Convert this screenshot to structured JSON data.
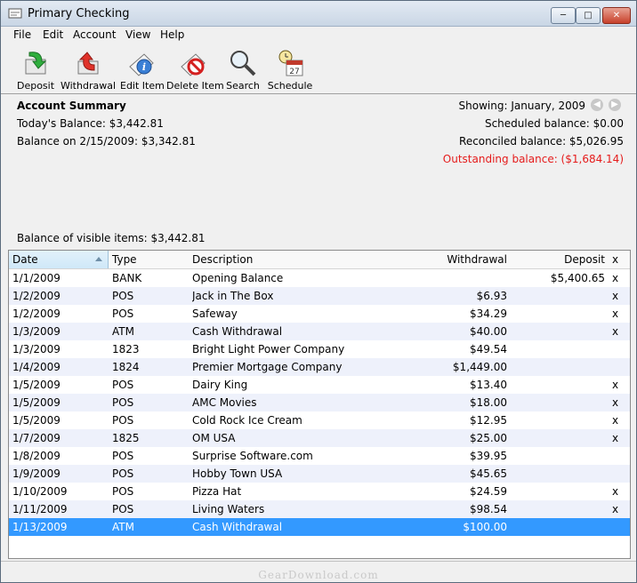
{
  "window": {
    "title": "Primary Checking"
  },
  "menu": [
    "File",
    "Edit",
    "Account",
    "View",
    "Help"
  ],
  "toolbar": {
    "deposit": "Deposit",
    "withdrawal": "Withdrawal",
    "edit_item": "Edit Item",
    "delete_item": "Delete Item",
    "search": "Search",
    "schedule": "Schedule",
    "schedule_day": "27"
  },
  "summary": {
    "heading": "Account Summary",
    "todays_balance": "Today's Balance: $3,442.81",
    "balance_on": "Balance on 2/15/2009: $3,342.81",
    "showing": "Showing: January, 2009",
    "scheduled": "Scheduled balance: $0.00",
    "reconciled": "Reconciled balance: $5,026.95",
    "outstanding": "Outstanding balance: ($1,684.14)",
    "visible": "Balance of visible items: $3,442.81"
  },
  "table": {
    "columns": {
      "date": "Date",
      "type": "Type",
      "description": "Description",
      "withdrawal": "Withdrawal",
      "deposit": "Deposit",
      "x": "x"
    },
    "rows": [
      {
        "date": "1/1/2009",
        "type": "BANK",
        "description": "Opening Balance",
        "withdrawal": "",
        "deposit": "$5,400.65",
        "x": "x"
      },
      {
        "date": "1/2/2009",
        "type": "POS",
        "description": "Jack in The Box",
        "withdrawal": "$6.93",
        "deposit": "",
        "x": "x"
      },
      {
        "date": "1/2/2009",
        "type": "POS",
        "description": "Safeway",
        "withdrawal": "$34.29",
        "deposit": "",
        "x": "x"
      },
      {
        "date": "1/3/2009",
        "type": "ATM",
        "description": "Cash Withdrawal",
        "withdrawal": "$40.00",
        "deposit": "",
        "x": "x"
      },
      {
        "date": "1/3/2009",
        "type": "1823",
        "description": "Bright Light Power Company",
        "withdrawal": "$49.54",
        "deposit": "",
        "x": ""
      },
      {
        "date": "1/4/2009",
        "type": "1824",
        "description": "Premier Mortgage Company",
        "withdrawal": "$1,449.00",
        "deposit": "",
        "x": ""
      },
      {
        "date": "1/5/2009",
        "type": "POS",
        "description": "Dairy King",
        "withdrawal": "$13.40",
        "deposit": "",
        "x": "x"
      },
      {
        "date": "1/5/2009",
        "type": "POS",
        "description": "AMC Movies",
        "withdrawal": "$18.00",
        "deposit": "",
        "x": "x"
      },
      {
        "date": "1/5/2009",
        "type": "POS",
        "description": "Cold Rock Ice Cream",
        "withdrawal": "$12.95",
        "deposit": "",
        "x": "x"
      },
      {
        "date": "1/7/2009",
        "type": "1825",
        "description": "OM USA",
        "withdrawal": "$25.00",
        "deposit": "",
        "x": "x"
      },
      {
        "date": "1/8/2009",
        "type": "POS",
        "description": "Surprise Software.com",
        "withdrawal": "$39.95",
        "deposit": "",
        "x": ""
      },
      {
        "date": "1/9/2009",
        "type": "POS",
        "description": "Hobby Town USA",
        "withdrawal": "$45.65",
        "deposit": "",
        "x": ""
      },
      {
        "date": "1/10/2009",
        "type": "POS",
        "description": "Pizza Hat",
        "withdrawal": "$24.59",
        "deposit": "",
        "x": "x"
      },
      {
        "date": "1/11/2009",
        "type": "POS",
        "description": "Living Waters",
        "withdrawal": "$98.54",
        "deposit": "",
        "x": "x"
      },
      {
        "date": "1/13/2009",
        "type": "ATM",
        "description": "Cash Withdrawal",
        "withdrawal": "$100.00",
        "deposit": "",
        "x": "",
        "selected": true
      }
    ]
  },
  "watermark": "GearDownload.com",
  "colors": {
    "selection": "#3399ff",
    "outstanding": "#e51b1b",
    "alt_row": "#eef1fb"
  }
}
